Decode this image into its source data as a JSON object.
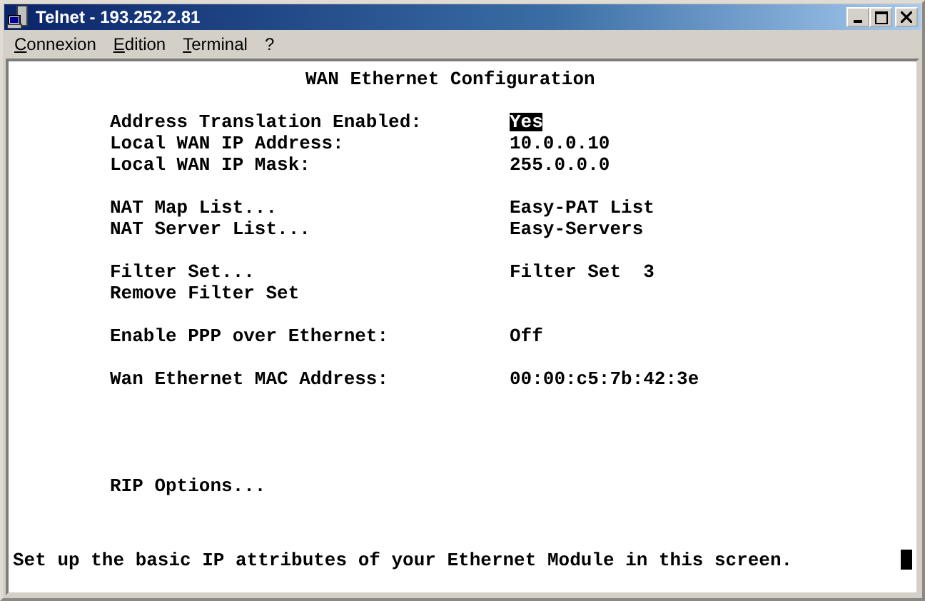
{
  "window": {
    "title": "Telnet - 193.252.2.81"
  },
  "menu": [
    {
      "label": "Connexion"
    },
    {
      "label": "Edition"
    },
    {
      "label": "Terminal"
    },
    {
      "label": "?"
    }
  ],
  "screen": {
    "title": "WAN Ethernet Configuration",
    "groups": [
      [
        {
          "label": "Address Translation Enabled:",
          "value": "Yes",
          "selected": true
        },
        {
          "label": "Local WAN IP Address:",
          "value": "10.0.0.10",
          "selected": false
        },
        {
          "label": "Local WAN IP Mask:",
          "value": "255.0.0.0",
          "selected": false
        }
      ],
      [
        {
          "label": "NAT Map List...",
          "value": "Easy-PAT List",
          "selected": false
        },
        {
          "label": "NAT Server List...",
          "value": "Easy-Servers",
          "selected": false
        }
      ],
      [
        {
          "label": "Filter Set...",
          "value": "Filter Set  3",
          "selected": false
        },
        {
          "label": "Remove Filter Set",
          "selected": false
        }
      ],
      [
        {
          "label": "Enable PPP over Ethernet:",
          "value": "Off",
          "selected": false
        }
      ],
      [
        {
          "label": "Wan Ethernet MAC Address:",
          "value": "00:00:c5:7b:42:3e",
          "selected": false
        }
      ]
    ],
    "bottom_items": [
      {
        "label": "RIP Options...",
        "selected": false
      }
    ],
    "status": "Set up the basic IP attributes of your Ethernet Module in this screen."
  }
}
